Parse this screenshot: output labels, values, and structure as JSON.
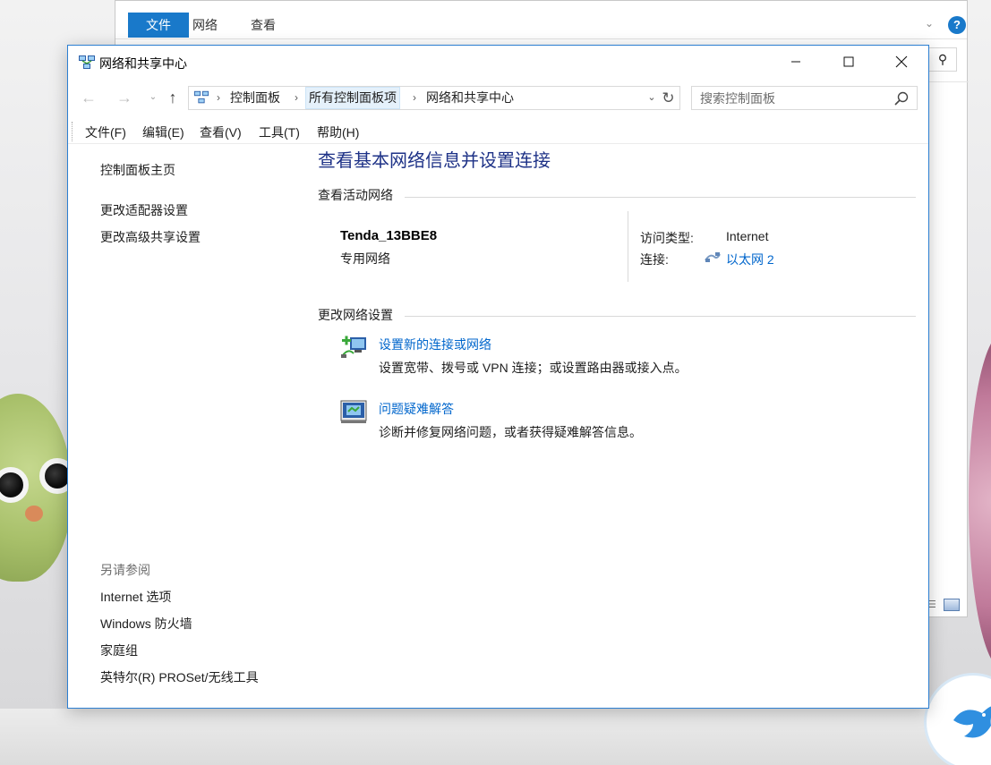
{
  "background_window": {
    "tabs": [
      "文件",
      "网络",
      "查看"
    ],
    "help_label": "?"
  },
  "window": {
    "title": "网络和共享中心",
    "icon": "network-center-icon"
  },
  "address_bar": {
    "breadcrumbs": [
      "控制面板",
      "所有控制面板项",
      "网络和共享中心"
    ],
    "search_placeholder": "搜索控制面板"
  },
  "menu": {
    "items": [
      "文件(F)",
      "编辑(E)",
      "查看(V)",
      "工具(T)",
      "帮助(H)"
    ]
  },
  "left_pane": {
    "links": [
      "控制面板主页",
      "更改适配器设置",
      "更改高级共享设置"
    ],
    "see_also_heading": "另请参阅",
    "see_also": [
      "Internet 选项",
      "Windows 防火墙",
      "家庭组",
      "英特尔(R) PROSet/无线工具"
    ]
  },
  "main": {
    "title": "查看基本网络信息并设置连接",
    "active_networks_heading": "查看活动网络",
    "network": {
      "name": "Tenda_13BBE8",
      "type": "专用网络",
      "access_type_label": "访问类型:",
      "access_type_value": "Internet",
      "connection_label": "连接:",
      "connection_value": "以太网 2"
    },
    "change_settings_heading": "更改网络设置",
    "tasks": [
      {
        "link": "设置新的连接或网络",
        "desc": "设置宽带、拨号或 VPN 连接；或设置路由器或接入点。",
        "icon": "new-connection-icon"
      },
      {
        "link": "问题疑难解答",
        "desc": "诊断并修复网络问题，或者获得疑难解答信息。",
        "icon": "troubleshoot-icon"
      }
    ]
  },
  "colors": {
    "accent": "#1979ca",
    "title_blue": "#1e3287",
    "link_blue": "#0066cc",
    "window_border": "#2c7fd2"
  }
}
